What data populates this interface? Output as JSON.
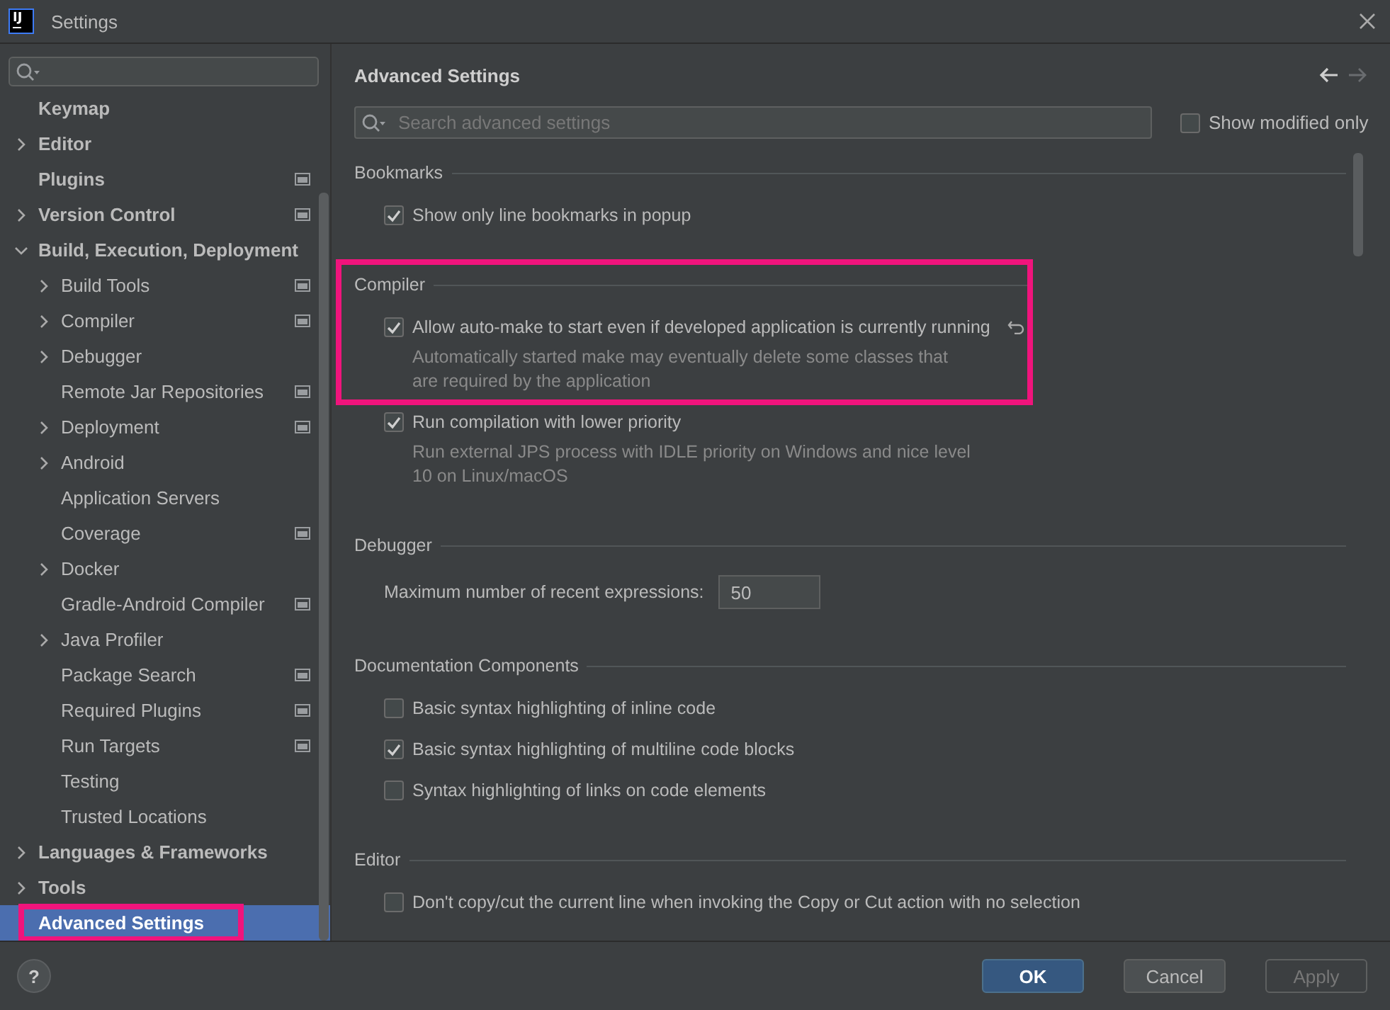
{
  "window": {
    "logo": "IJ",
    "title": "Settings"
  },
  "sidebar": {
    "items": [
      {
        "label": "Keymap",
        "project_level": false,
        "selected": false,
        "highlighted": false
      },
      {
        "label": "Editor",
        "expanded": false,
        "project_level": false,
        "selected": false,
        "highlighted": false
      },
      {
        "label": "Plugins",
        "project_level": true,
        "selected": false,
        "highlighted": false
      },
      {
        "label": "Version Control",
        "expanded": false,
        "project_level": true,
        "selected": false,
        "highlighted": false
      },
      {
        "label": "Build, Execution, Deployment",
        "expanded": true,
        "project_level": false,
        "selected": false,
        "highlighted": false,
        "children": [
          {
            "label": "Build Tools",
            "expanded": false,
            "project_level": true,
            "selected": false,
            "highlighted": false
          },
          {
            "label": "Compiler",
            "expanded": false,
            "project_level": true,
            "selected": false,
            "highlighted": false
          },
          {
            "label": "Debugger",
            "expanded": false,
            "project_level": false,
            "selected": false,
            "highlighted": false
          },
          {
            "label": "Remote Jar Repositories",
            "project_level": true,
            "selected": false,
            "highlighted": false
          },
          {
            "label": "Deployment",
            "expanded": false,
            "project_level": true,
            "selected": false,
            "highlighted": false
          },
          {
            "label": "Android",
            "expanded": false,
            "project_level": false,
            "selected": false,
            "highlighted": false
          },
          {
            "label": "Application Servers",
            "project_level": false,
            "selected": false,
            "highlighted": false
          },
          {
            "label": "Coverage",
            "project_level": true,
            "selected": false,
            "highlighted": false
          },
          {
            "label": "Docker",
            "expanded": false,
            "project_level": false,
            "selected": false,
            "highlighted": false
          },
          {
            "label": "Gradle-Android Compiler",
            "project_level": true,
            "selected": false,
            "highlighted": false
          },
          {
            "label": "Java Profiler",
            "expanded": false,
            "project_level": false,
            "selected": false,
            "highlighted": false
          },
          {
            "label": "Package Search",
            "project_level": true,
            "selected": false,
            "highlighted": false
          },
          {
            "label": "Required Plugins",
            "project_level": true,
            "selected": false,
            "highlighted": false
          },
          {
            "label": "Run Targets",
            "project_level": true,
            "selected": false,
            "highlighted": false
          },
          {
            "label": "Testing",
            "project_level": false,
            "selected": false,
            "highlighted": false
          },
          {
            "label": "Trusted Locations",
            "project_level": false,
            "selected": false,
            "highlighted": false
          }
        ]
      },
      {
        "label": "Languages & Frameworks",
        "expanded": false,
        "project_level": false,
        "selected": false,
        "highlighted": false
      },
      {
        "label": "Tools",
        "expanded": false,
        "project_level": false,
        "selected": false,
        "highlighted": false
      },
      {
        "label": "Advanced Settings",
        "project_level": false,
        "selected": true,
        "highlighted": true
      }
    ]
  },
  "content": {
    "title": "Advanced Settings",
    "search": {
      "placeholder": "Search advanced settings"
    },
    "show_modified_only": {
      "label": "Show modified only",
      "checked": false
    },
    "sections": [
      {
        "title": "Bookmarks",
        "highlighted": false,
        "items": [
          {
            "kind": "checkbox",
            "label": "Show only line bookmarks in popup",
            "checked": true,
            "modified": false
          }
        ]
      },
      {
        "title": "Compiler",
        "highlighted": true,
        "items": [
          {
            "kind": "checkbox",
            "label": "Allow auto-make to start even if developed application is currently running",
            "checked": true,
            "modified": true,
            "description": "Automatically started make may eventually delete some classes that are required by the application"
          },
          {
            "kind": "checkbox",
            "label": "Run compilation with lower priority",
            "checked": true,
            "modified": false,
            "description": "Run external JPS process with IDLE priority on Windows and nice level 10 on Linux/macOS"
          }
        ]
      },
      {
        "title": "Debugger",
        "highlighted": false,
        "items": [
          {
            "kind": "number",
            "label": "Maximum number of recent expressions:",
            "value": "50",
            "modified": false
          }
        ]
      },
      {
        "title": "Documentation Components",
        "highlighted": false,
        "items": [
          {
            "kind": "checkbox",
            "label": "Basic syntax highlighting of inline code",
            "checked": false,
            "modified": false
          },
          {
            "kind": "checkbox",
            "label": "Basic syntax highlighting of multiline code blocks",
            "checked": true,
            "modified": false
          },
          {
            "kind": "checkbox",
            "label": "Syntax highlighting of links on code elements",
            "checked": false,
            "modified": false
          }
        ]
      },
      {
        "title": "Editor",
        "highlighted": false,
        "items": [
          {
            "kind": "checkbox",
            "label": "Don't copy/cut the current line when invoking the Copy or Cut action with no selection",
            "checked": false,
            "modified": false
          }
        ]
      }
    ]
  },
  "help": {
    "label": "?"
  },
  "buttons": [
    {
      "label": "OK",
      "kind": "default"
    },
    {
      "label": "Cancel",
      "kind": "normal"
    },
    {
      "label": "Apply",
      "kind": "disabled"
    }
  ]
}
